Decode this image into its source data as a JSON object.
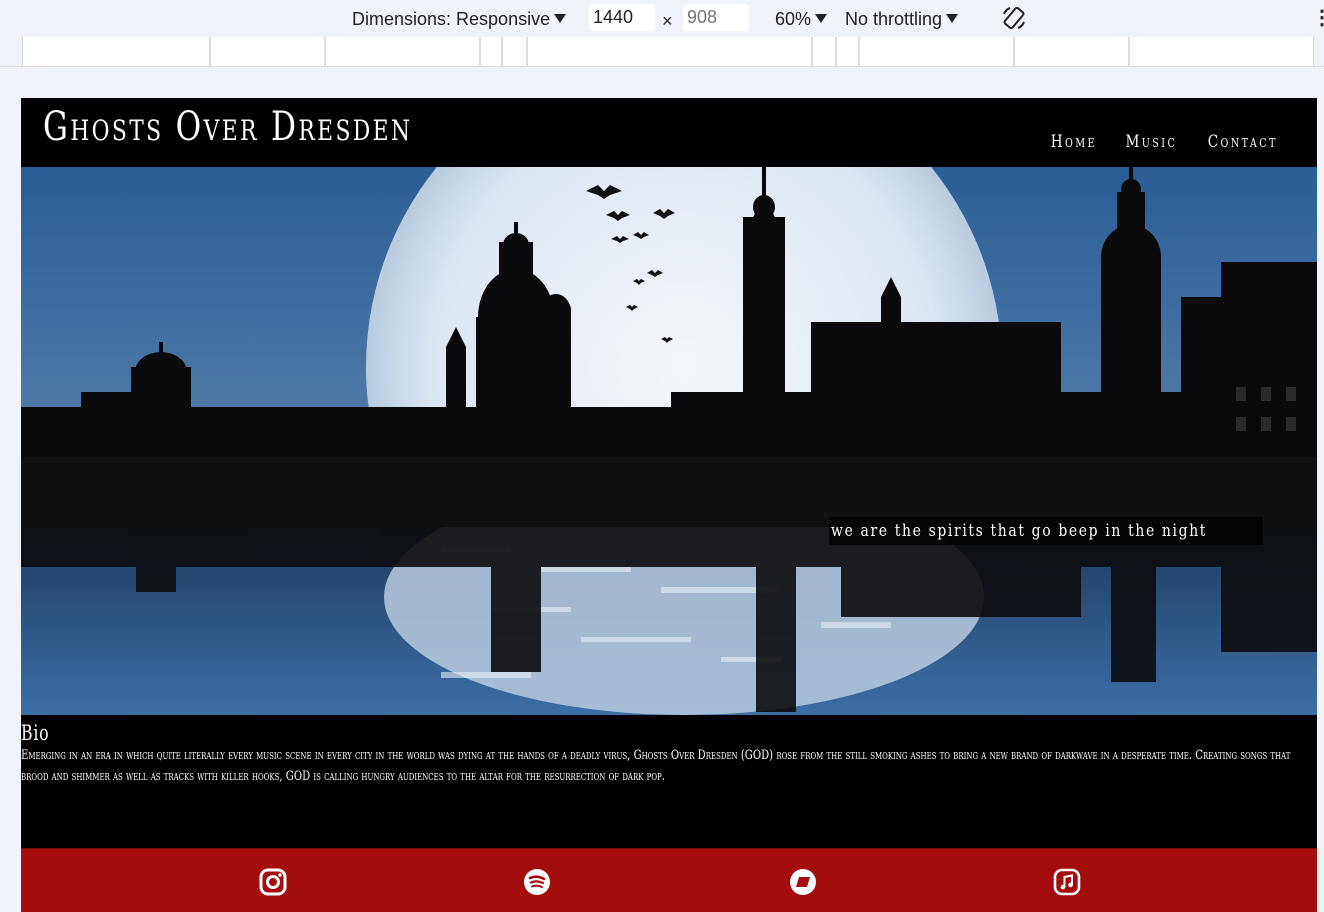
{
  "devtools": {
    "dimensions_label": "Dimensions: Responsive",
    "width_value": "1440",
    "times": "×",
    "height_placeholder": "908",
    "zoom": "60%",
    "throttling": "No throttling",
    "rotate_icon": "rotate-icon",
    "more_icon": "more-vertical-icon",
    "more_glyph": "⋮"
  },
  "site": {
    "title": "Ghosts Over Dresden",
    "nav": [
      "Home",
      "Music",
      "Contact"
    ],
    "tagline": "we are the spirits that go beep in the night",
    "bio_heading": "Bio",
    "bio_text": "Emerging in an era in which quite literally every music scene in every city in the world was dying at the hands of a deadly virus, Ghosts Over Dresden (GOD) rose from the still smoking ashes to bring a new brand of darkwave in a desperate time. Creating songs that brood and shimmer as well as tracks with killer hooks, GOD is calling hungry audiences to the altar for the resurrection of dark pop.",
    "social_icons": [
      "instagram-icon",
      "spotify-icon",
      "bandcamp-icon",
      "apple-music-icon"
    ]
  },
  "colors": {
    "footer": "#a30d0d",
    "header": "#000000",
    "sky": "#3d6ea5"
  }
}
